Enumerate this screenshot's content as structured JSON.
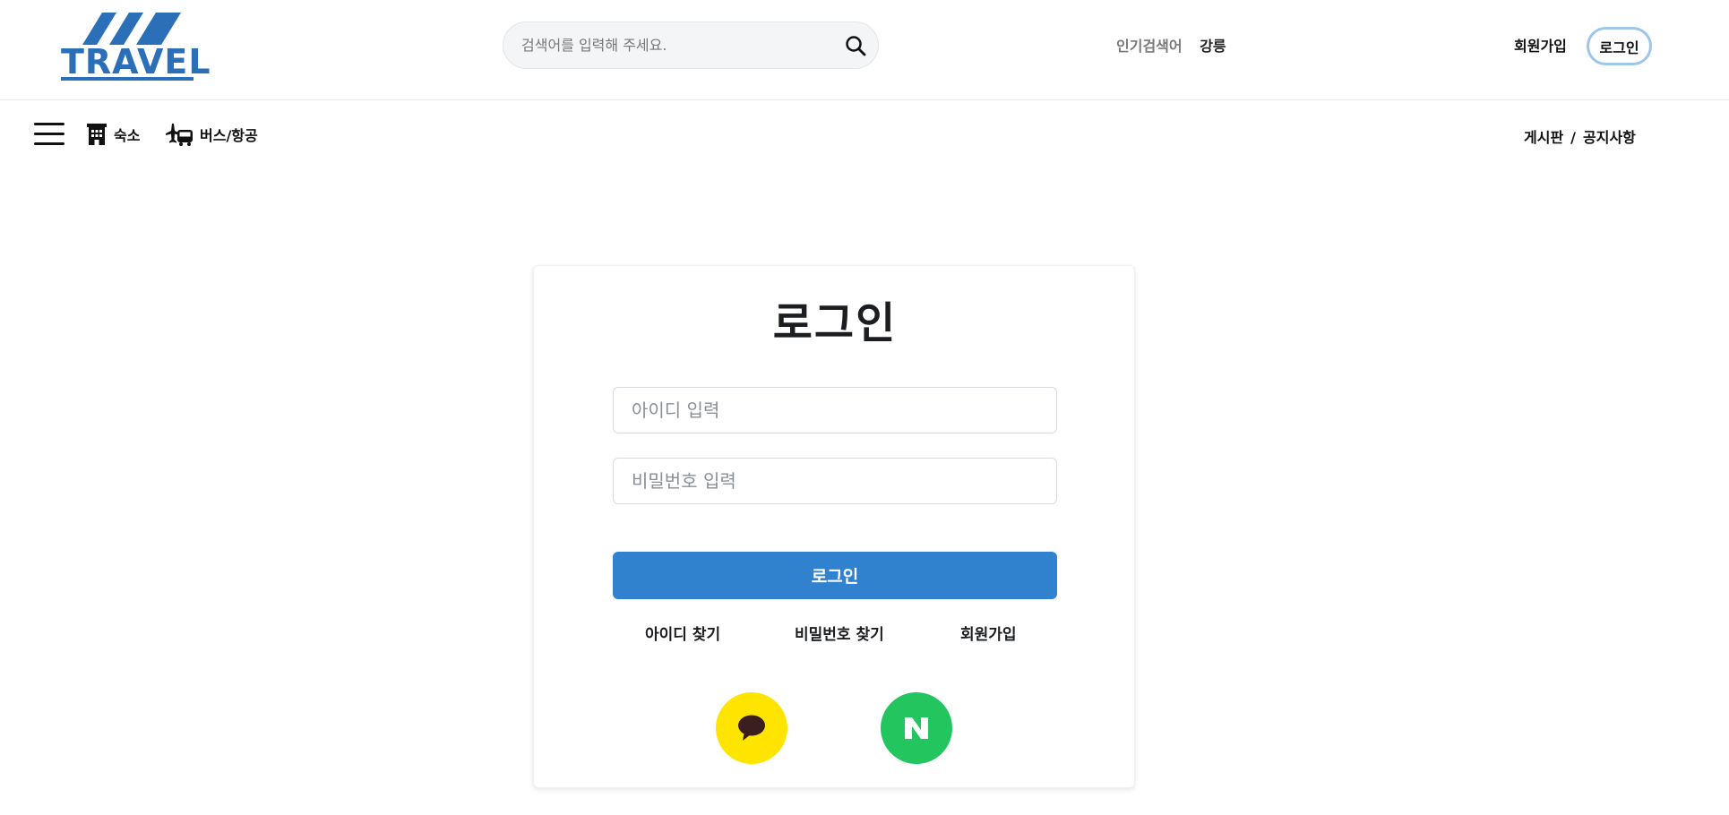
{
  "header": {
    "logo_text": "TRAVEL",
    "search_placeholder": "검색어를 입력해 주세요.",
    "popular_label": "인기검색어",
    "popular_keyword": "강릉",
    "signup_label": "회원가입",
    "login_label": "로그인"
  },
  "subnav": {
    "items": [
      {
        "label": "숙소",
        "icon": "building-icon"
      },
      {
        "label": "버스/항공",
        "icon": "plane-bus-icon"
      }
    ],
    "board_label": "게시판",
    "separator": "/",
    "notice_label": "공지사항"
  },
  "login": {
    "title": "로그인",
    "id_placeholder": "아이디 입력",
    "pw_placeholder": "비밀번호 입력",
    "submit_label": "로그인",
    "links": {
      "find_id": "아이디 찾기",
      "find_pw": "비밀번호 찾기",
      "signup": "회원가입"
    },
    "social": [
      {
        "name": "kakao",
        "icon": "kakao-icon",
        "color": "#fee500"
      },
      {
        "name": "naver",
        "icon": "naver-icon",
        "color": "#22c55e"
      }
    ]
  },
  "colors": {
    "brand": "#2a6fb8",
    "primary_button": "#3182ce",
    "login_outline": "#9ec5ea"
  }
}
